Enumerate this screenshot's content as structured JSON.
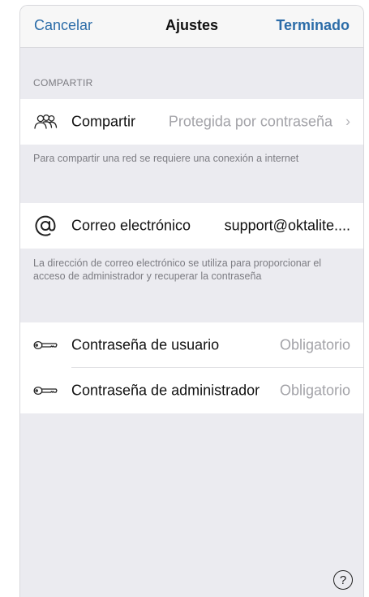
{
  "navbar": {
    "cancel_label": "Cancelar",
    "title": "Ajustes",
    "done_label": "Terminado"
  },
  "share_section": {
    "header": "COMPARTIR",
    "share_label": "Compartir",
    "share_value": "Protegida por contraseña",
    "share_icon": "people-group-icon",
    "chevron": "›",
    "footer": "Para compartir una red se requiere una conexión a internet"
  },
  "email_section": {
    "email_label": "Correo electrónico",
    "email_value": "support@oktalite....",
    "email_icon": "at-sign-icon",
    "footer": "La dirección de correo electrónico se utiliza para proporcionar el acceso de administrador y recuperar la contraseña"
  },
  "password_section": {
    "user_password_label": "Contraseña de usuario",
    "user_password_placeholder": "Obligatorio",
    "admin_password_label": "Contraseña de administrador",
    "admin_password_placeholder": "Obligatorio",
    "key_icon": "key-icon"
  },
  "help": {
    "label": "?"
  },
  "colors": {
    "accent": "#2b6ca8",
    "background": "#ebebf0",
    "secondary_text": "#7c7c82",
    "placeholder_text": "#a3a3a8"
  }
}
